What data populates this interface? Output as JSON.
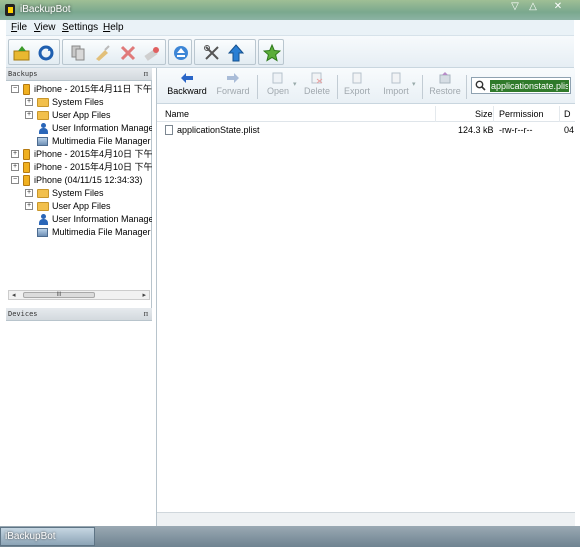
{
  "window": {
    "title": "iBackupBot",
    "controls": {
      "minimize": "▽",
      "maximize": "△",
      "close": "✕"
    }
  },
  "menu": {
    "items": [
      {
        "label": "File",
        "accel": "F",
        "rest": "ile"
      },
      {
        "label": "View",
        "accel": "V",
        "rest": "iew"
      },
      {
        "label": "Settings",
        "accel": "S",
        "rest": "ettings"
      },
      {
        "label": "Help",
        "accel": "H",
        "rest": "elp"
      }
    ]
  },
  "toolbar": {
    "icons": [
      "open-backup-icon",
      "refresh-icon",
      "copy-icon",
      "clean-icon",
      "delete-icon",
      "erase-icon",
      "eject-icon",
      "tools-icon",
      "upload-icon",
      "favorite-icon"
    ]
  },
  "backups_panel": {
    "title": "Backups",
    "pin": "ᴨ",
    "tree": [
      {
        "label": "iPhone - 2015年4月11日 下午",
        "type": "phone",
        "expander": "−",
        "level": 0
      },
      {
        "label": "System Files",
        "type": "folder",
        "expander": "+",
        "level": 1
      },
      {
        "label": "User App Files",
        "type": "folder",
        "expander": "+",
        "level": 1
      },
      {
        "label": "User Information Manage",
        "type": "user",
        "expander": "",
        "level": 1
      },
      {
        "label": "Multimedia File Manager",
        "type": "media",
        "expander": "",
        "level": 1
      },
      {
        "label": "iPhone - 2015年4月10日 下午",
        "type": "phone",
        "expander": "+",
        "level": 0
      },
      {
        "label": "iPhone - 2015年4月10日 下午",
        "type": "phone",
        "expander": "+",
        "level": 0
      },
      {
        "label": "iPhone (04/11/15 12:34:33)",
        "type": "phone",
        "expander": "−",
        "level": 0
      },
      {
        "label": "System Files",
        "type": "folder",
        "expander": "+",
        "level": 1
      },
      {
        "label": "User App Files",
        "type": "folder",
        "expander": "+",
        "level": 1
      },
      {
        "label": "User Information Manage",
        "type": "user",
        "expander": "",
        "level": 1
      },
      {
        "label": "Multimedia File Manager",
        "type": "media",
        "expander": "",
        "level": 1
      }
    ],
    "scroll_thumb": "III",
    "scroll_left": "◂",
    "scroll_right": "▸"
  },
  "devices_panel": {
    "title": "Devices",
    "pin": "ᴨ"
  },
  "file_toolbar": {
    "buttons": [
      {
        "label": "Backward",
        "enabled": true,
        "icon": "arrow-left-icon"
      },
      {
        "label": "Forward",
        "enabled": false,
        "icon": "arrow-right-icon"
      },
      {
        "label": "Open",
        "enabled": false,
        "icon": "open-file-icon"
      },
      {
        "label": "Delete",
        "enabled": false,
        "icon": "delete-file-icon"
      },
      {
        "label": "Export",
        "enabled": false,
        "icon": "export-icon"
      },
      {
        "label": "Import",
        "enabled": false,
        "icon": "import-icon"
      },
      {
        "label": "Restore",
        "enabled": false,
        "icon": "restore-icon"
      }
    ],
    "search_value": "applicationstate.plist"
  },
  "file_list": {
    "columns": [
      "Name",
      "Size",
      "Permission",
      "D"
    ],
    "rows": [
      {
        "name": "applicationState.plist",
        "size": "124.3 kB",
        "permission": "-rw-r--r--",
        "date": "04"
      }
    ]
  },
  "taskbar": {
    "item": "iBackupBot"
  }
}
